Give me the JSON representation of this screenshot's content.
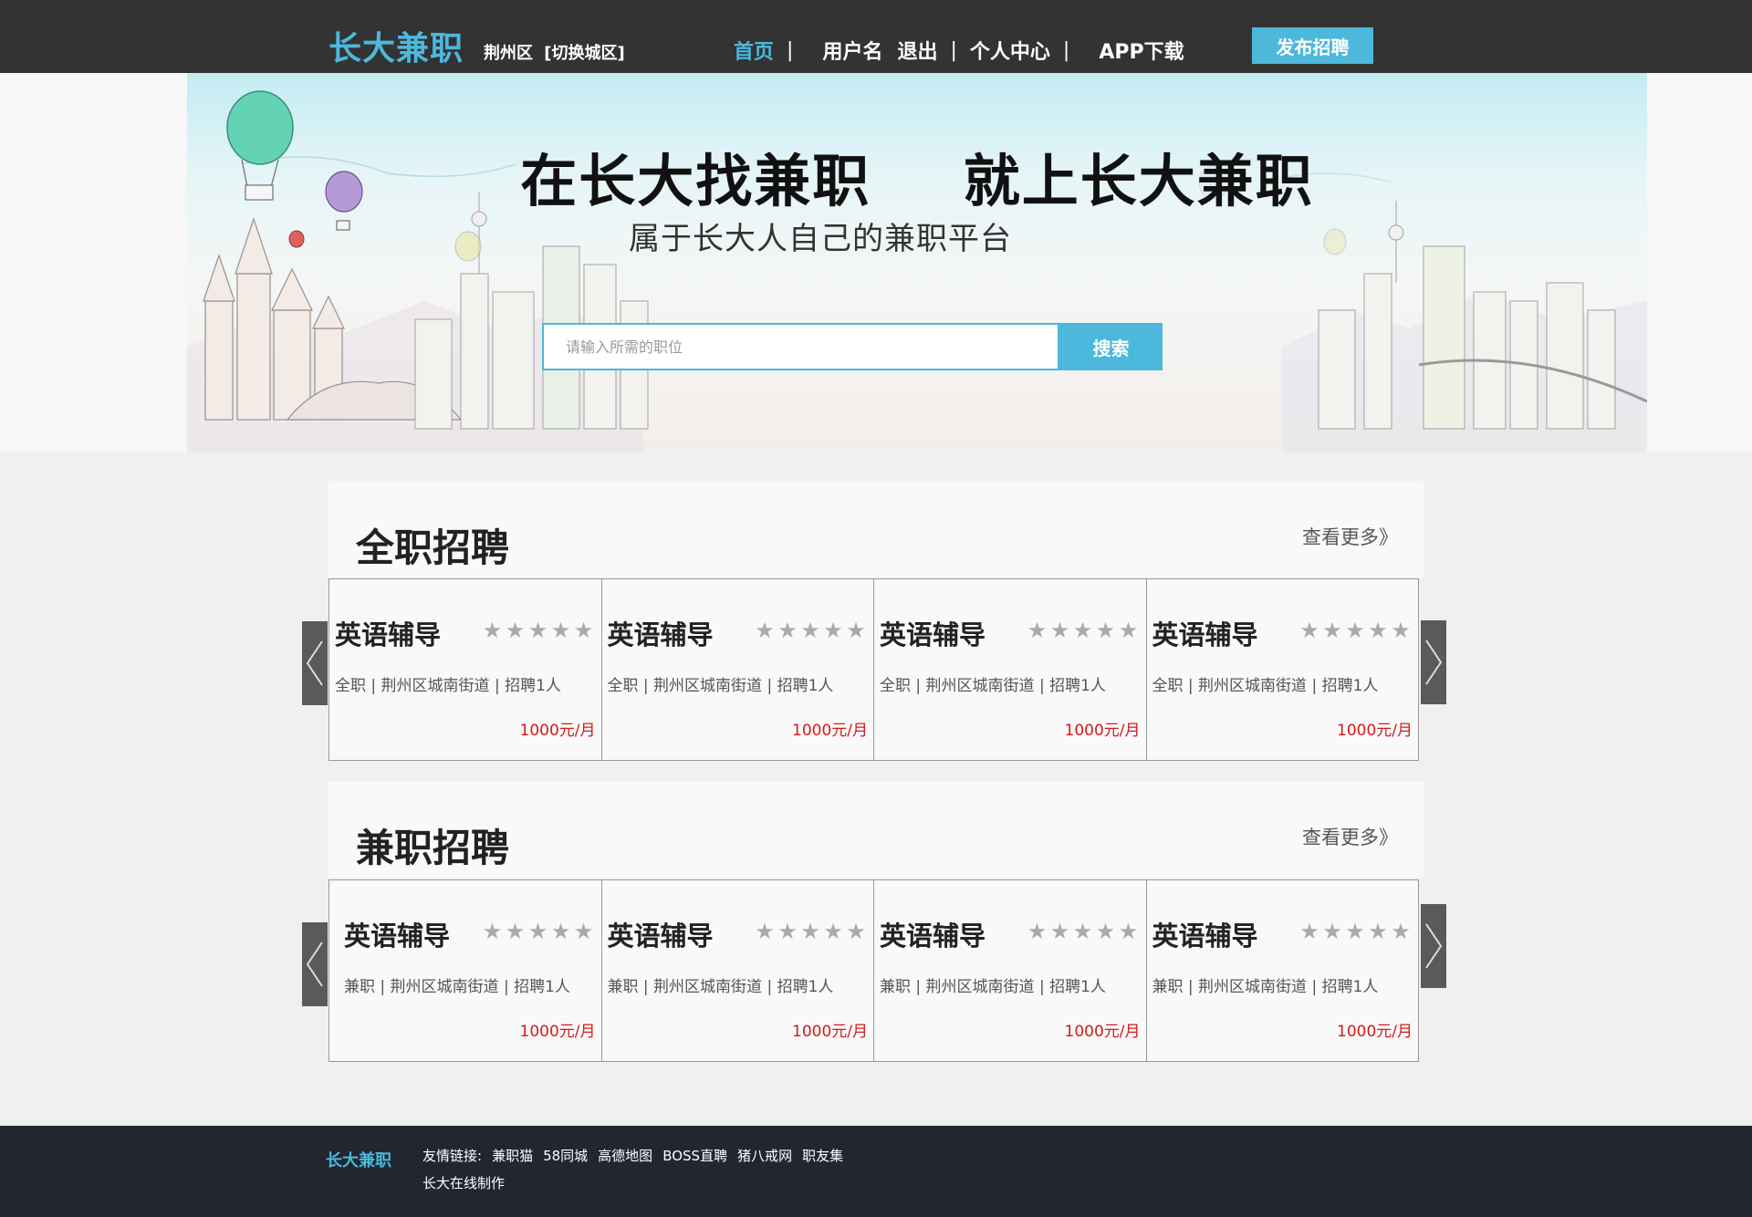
{
  "header": {
    "logo": "长大兼职",
    "city": "荆州区",
    "switch_city": "[切换城区]",
    "nav": {
      "home": "首页",
      "username": "用户名",
      "logout": "退出",
      "profile": "个人中心",
      "app": "APP下载",
      "separator": "|"
    },
    "publish_label": "发布招聘"
  },
  "hero": {
    "title_part1": "在长大找兼职",
    "title_part2": "就上长大兼职",
    "subtitle": "属于长大人自己的兼职平台",
    "search_placeholder": "请输入所需的职位",
    "search_label": "搜索"
  },
  "fulltime": {
    "title": "全职招聘",
    "more": "查看更多》",
    "jobs": [
      {
        "name": "英语辅导",
        "meta": "全职 | 荆州区城南街道 | 招聘1人",
        "salary": "1000元/月"
      },
      {
        "name": "英语辅导",
        "meta": "全职 | 荆州区城南街道 | 招聘1人",
        "salary": "1000元/月"
      },
      {
        "name": "英语辅导",
        "meta": "全职 | 荆州区城南街道 | 招聘1人",
        "salary": "1000元/月"
      },
      {
        "name": "英语辅导",
        "meta": "全职 | 荆州区城南街道 | 招聘1人",
        "salary": "1000元/月"
      }
    ]
  },
  "parttime": {
    "title": "兼职招聘",
    "more": "查看更多》",
    "jobs": [
      {
        "name": "英语辅导",
        "meta": "兼职 | 荆州区城南街道 | 招聘1人",
        "salary": "1000元/月"
      },
      {
        "name": "英语辅导",
        "meta": "兼职 | 荆州区城南街道 | 招聘1人",
        "salary": "1000元/月"
      },
      {
        "name": "英语辅导",
        "meta": "兼职 | 荆州区城南街道 | 招聘1人",
        "salary": "1000元/月"
      },
      {
        "name": "英语辅导",
        "meta": "兼职 | 荆州区城南街道 | 招聘1人",
        "salary": "1000元/月"
      }
    ]
  },
  "star_glyph": "★",
  "footer": {
    "logo": "长大兼职",
    "links_label": "友情链接:",
    "links": [
      "兼职猫",
      "58同城",
      "高德地图",
      "BOSS直聘",
      "猪八戒网",
      "职友集"
    ],
    "credit": "长大在线制作"
  },
  "colors": {
    "accent": "#4cb8db",
    "salary": "#d51a1a",
    "topbar": "#333333",
    "footer": "#222631"
  },
  "icons": [
    "chevron-left-icon",
    "chevron-right-icon",
    "star-icon",
    "hot-air-balloon-icon"
  ]
}
